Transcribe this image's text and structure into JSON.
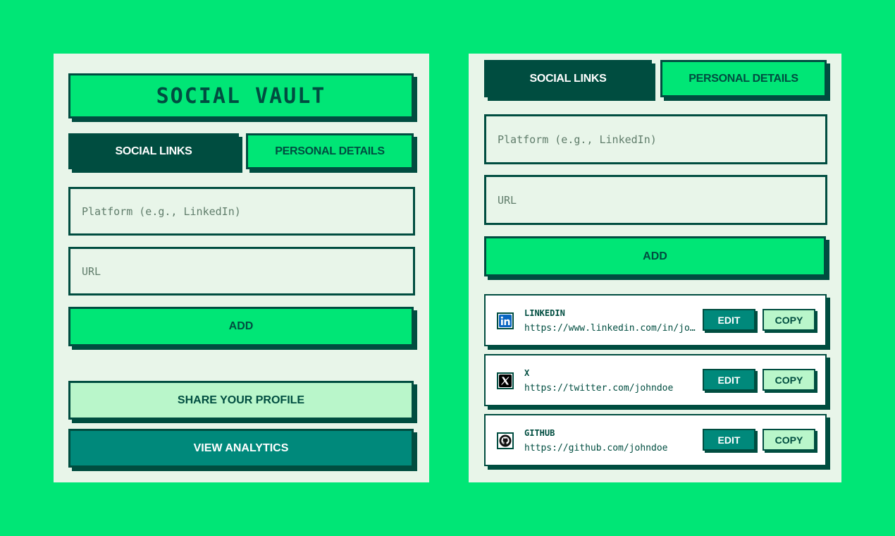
{
  "app": {
    "title": "SOCIAL VAULT"
  },
  "tabs": {
    "social_links": "SOCIAL LINKS",
    "personal_details": "PERSONAL DETAILS"
  },
  "form": {
    "platform_placeholder": "Platform (e.g., LinkedIn)",
    "url_placeholder": "URL",
    "add_label": "ADD"
  },
  "actions": {
    "share_label": "SHARE YOUR PROFILE",
    "analytics_label": "VIEW ANALYTICS"
  },
  "links": [
    {
      "name": "LINKEDIN",
      "url": "https://www.linkedin.com/in/johndoe",
      "icon": "linkedin-icon"
    },
    {
      "name": "X",
      "url": "https://twitter.com/johndoe",
      "icon": "x-icon"
    },
    {
      "name": "GITHUB",
      "url": "https://github.com/johndoe",
      "icon": "github-icon"
    }
  ],
  "link_actions": {
    "edit_label": "EDIT",
    "copy_label": "COPY"
  },
  "colors": {
    "background": "#00e676",
    "panel": "#e8f5e9",
    "dark": "#004d40",
    "teal": "#00897b",
    "light_mint": "#b9f6ca",
    "linkedin_blue": "#0a66c2"
  }
}
